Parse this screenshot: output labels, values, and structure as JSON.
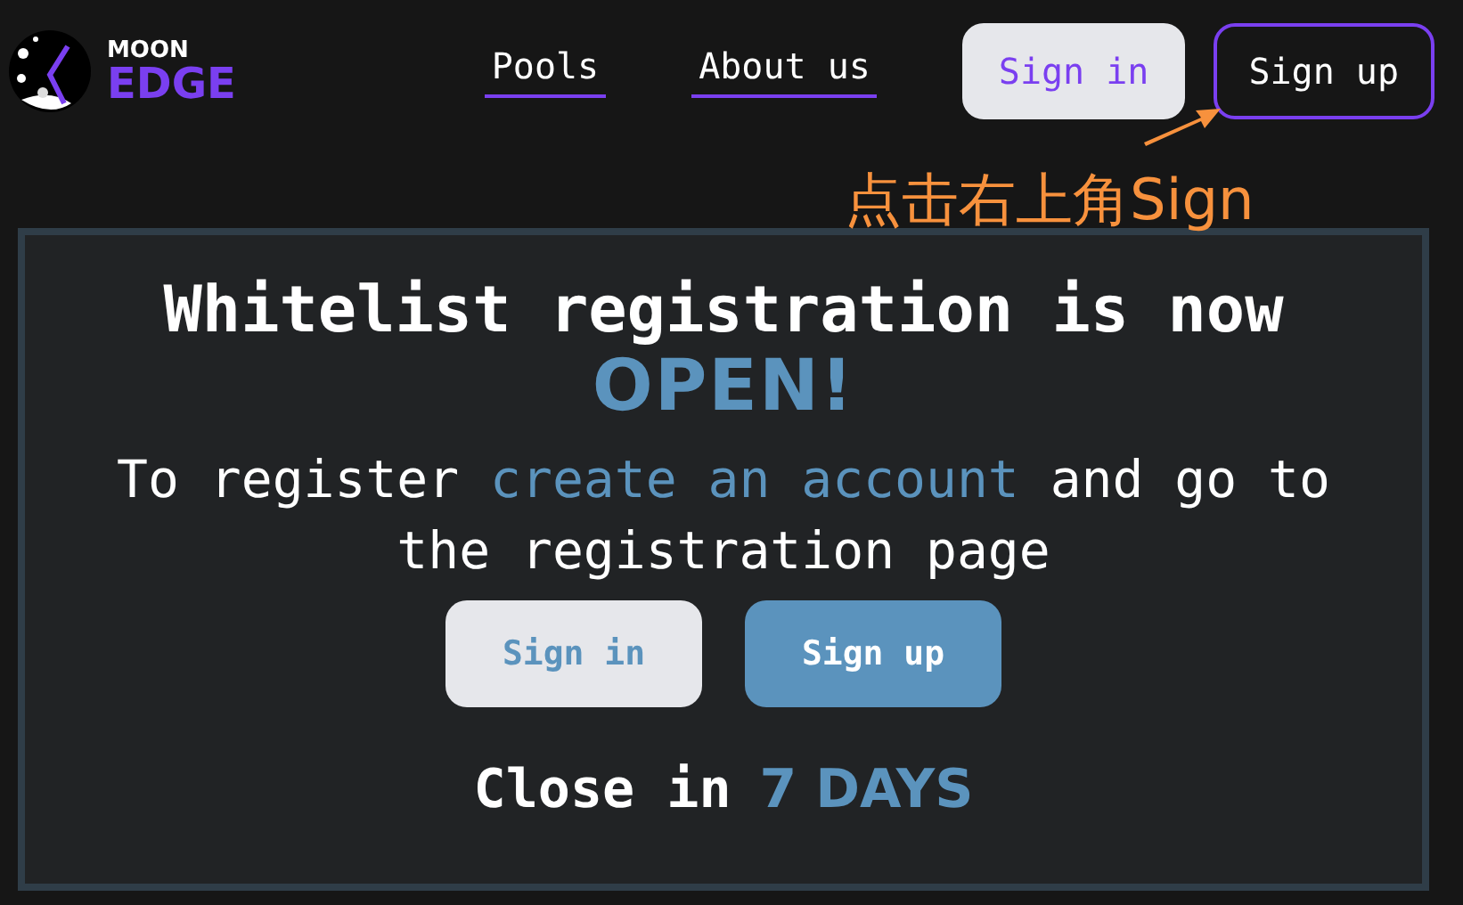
{
  "logo": {
    "top": "MOON",
    "bottom": "EDGE"
  },
  "nav": [
    {
      "label": "Pools"
    },
    {
      "label": "About us"
    }
  ],
  "header_buttons": [
    {
      "label": "Sign in",
      "kind": "light"
    },
    {
      "label": "Sign up",
      "kind": "outline"
    }
  ],
  "annotation": {
    "text": "点击右上角Sign"
  },
  "banner": {
    "title": "Whitelist registration is now",
    "highlight": "OPEN!",
    "text_before": "To register",
    "link": "create an account",
    "text_after": "and go to the registration page",
    "buttons": [
      {
        "label": "Sign in",
        "kind": "light"
      },
      {
        "label": "Sign up",
        "kind": "primary"
      }
    ],
    "close_label": "Close in",
    "close_value": "7 DAYS"
  }
}
